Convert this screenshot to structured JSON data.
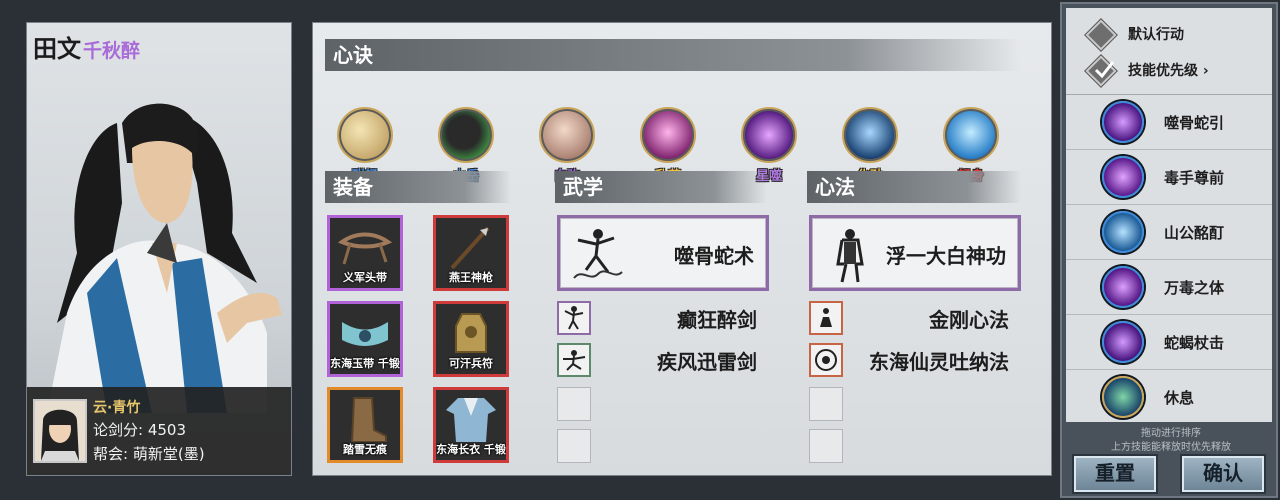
{
  "character": {
    "name": "田文",
    "title": "千秋醉"
  },
  "owner": {
    "name": "云·青竹",
    "rating_label": "论剑分:",
    "rating": "4503",
    "guild_label": "帮会:",
    "guild": "萌新堂(墨)"
  },
  "sections": {
    "xinjue": "心诀",
    "equip": "装备",
    "wuxue": "武学",
    "xinfa": "心法"
  },
  "skills": [
    {
      "label": "酣畅",
      "icon": "wine-gourd-icon",
      "label_color": "#4a8fe0"
    },
    {
      "label": "山岳",
      "icon": "mountain-rock-icon",
      "label_color": "#4a8fe0"
    },
    {
      "label": "白驹",
      "icon": "white-horse-icon",
      "label_color": "#9b6ad8"
    },
    {
      "label": "乱花",
      "icon": "swirl-flower-icon",
      "label_color": "#f2c14a"
    },
    {
      "label": "星噬",
      "icon": "purple-slash-icon",
      "label_color": "#b07ae0"
    },
    {
      "label": "化劲",
      "icon": "stance-figure-icon",
      "label_color": "#f2c14a"
    },
    {
      "label": "轻身",
      "icon": "leaping-figure-icon",
      "label_color": "#e03a3a"
    }
  ],
  "equipment": [
    {
      "label": "义军头带",
      "icon": "headband-icon",
      "border": "#b062d6"
    },
    {
      "label": "燕王神枪",
      "icon": "spear-icon",
      "border": "#cf3b3b"
    },
    {
      "label": "东海玉带 千锻",
      "icon": "jade-belt-icon",
      "border": "#b062d6"
    },
    {
      "label": "可汗兵符",
      "icon": "tiger-tally-icon",
      "border": "#cf3b3b"
    },
    {
      "label": "踏雪无痕",
      "icon": "boots-icon",
      "border": "#e38a2a"
    },
    {
      "label": "东海长衣 千锻",
      "icon": "robe-icon",
      "border": "#cf3b3b"
    }
  ],
  "wuxue": {
    "main": {
      "name": "噬骨蛇术",
      "icon": "snake-fighter-icon"
    },
    "list": [
      {
        "name": "癫狂醉剑",
        "icon": "drunk-sword-icon",
        "border": "#8e6aa6"
      },
      {
        "name": "疾风迅雷剑",
        "icon": "wind-sword-icon",
        "border": "#5c8a6a"
      }
    ]
  },
  "xinfa": {
    "main": {
      "name": "浮一大白神功",
      "icon": "drinking-monk-icon"
    },
    "list": [
      {
        "name": "金刚心法",
        "icon": "vajra-sit-icon",
        "border": "#c86446"
      },
      {
        "name": "东海仙灵吐纳法",
        "icon": "breath-lotus-icon",
        "border": "#c86446"
      }
    ]
  },
  "right_panel": {
    "default_action": "默认行动",
    "skill_priority": "技能优先级",
    "chevron": "›",
    "priority_list": [
      {
        "name": "噬骨蛇引",
        "icon": "snake-strike-icon"
      },
      {
        "name": "毒手尊前",
        "icon": "poison-hand-icon"
      },
      {
        "name": "山公酩酊",
        "icon": "drunk-stance-icon"
      },
      {
        "name": "万毒之体",
        "icon": "poison-body-icon"
      },
      {
        "name": "蛇蝎杖击",
        "icon": "staff-strike-icon"
      },
      {
        "name": "休息",
        "icon": "meditate-icon"
      }
    ],
    "hint1": "拖动进行排序",
    "hint2": "上方技能能释放时优先释放",
    "reset": "重置",
    "confirm": "确认"
  }
}
